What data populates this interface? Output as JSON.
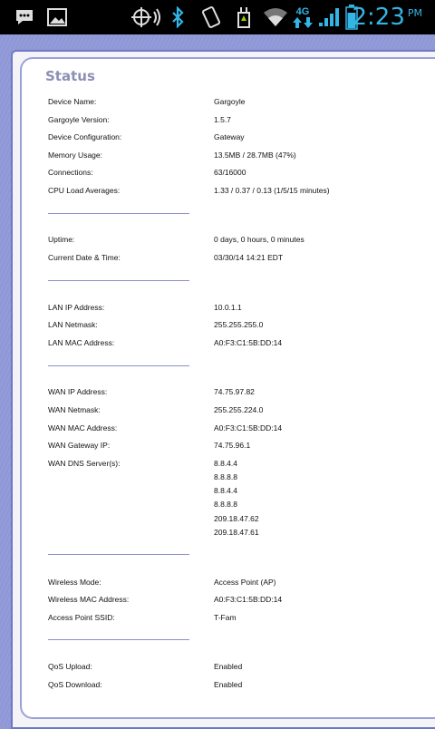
{
  "statusbar": {
    "time": "2:23",
    "ampm": "PM",
    "network_label": "4G",
    "icons": [
      "chat-icon",
      "gallery-icon",
      "location-icon",
      "bluetooth-icon",
      "vibrate-icon",
      "usb-icon",
      "wifi-icon",
      "data-arrows-icon",
      "signal-icon",
      "battery-icon"
    ]
  },
  "status": {
    "title": "Status",
    "sections": [
      [
        {
          "label": "Device Name:",
          "value": "Gargoyle"
        },
        {
          "label": "Gargoyle Version:",
          "value": "1.5.7"
        },
        {
          "label": "Device Configuration:",
          "value": "Gateway"
        },
        {
          "label": "Memory Usage:",
          "value": "13.5MB / 28.7MB (47%)"
        },
        {
          "label": "Connections:",
          "value": "63/16000"
        },
        {
          "label": "CPU Load Averages:",
          "value": "1.33 / 0.37 / 0.13  (1/5/15 minutes)"
        }
      ],
      [
        {
          "label": "Uptime:",
          "value": "0 days, 0 hours, 0 minutes"
        },
        {
          "label": "Current Date & Time:",
          "value": "03/30/14 14:21 EDT"
        }
      ],
      [
        {
          "label": "LAN IP Address:",
          "value": "10.0.1.1"
        },
        {
          "label": "LAN Netmask:",
          "value": "255.255.255.0"
        },
        {
          "label": "LAN MAC Address:",
          "value": "A0:F3:C1:5B:DD:14"
        }
      ],
      [
        {
          "label": "WAN IP Address:",
          "value": "74.75.97.82"
        },
        {
          "label": "WAN Netmask:",
          "value": "255.255.224.0"
        },
        {
          "label": "WAN MAC Address:",
          "value": "A0:F3:C1:5B:DD:14"
        },
        {
          "label": "WAN Gateway IP:",
          "value": "74.75.96.1"
        },
        {
          "label": "WAN DNS Server(s):",
          "values": [
            "8.8.4.4",
            "8.8.8.8",
            "8.8.4.4",
            "8.8.8.8",
            "209.18.47.62",
            "209.18.47.61"
          ]
        }
      ],
      [
        {
          "label": "Wireless Mode:",
          "value": "Access Point (AP)"
        },
        {
          "label": "Wireless MAC Address:",
          "value": "A0:F3:C1:5B:DD:14"
        },
        {
          "label": "Access Point SSID:",
          "value": "T-Fam"
        }
      ],
      [
        {
          "label": "QoS Upload:",
          "value": "Enabled"
        },
        {
          "label": "QoS Download:",
          "value": "Enabled"
        }
      ]
    ]
  }
}
